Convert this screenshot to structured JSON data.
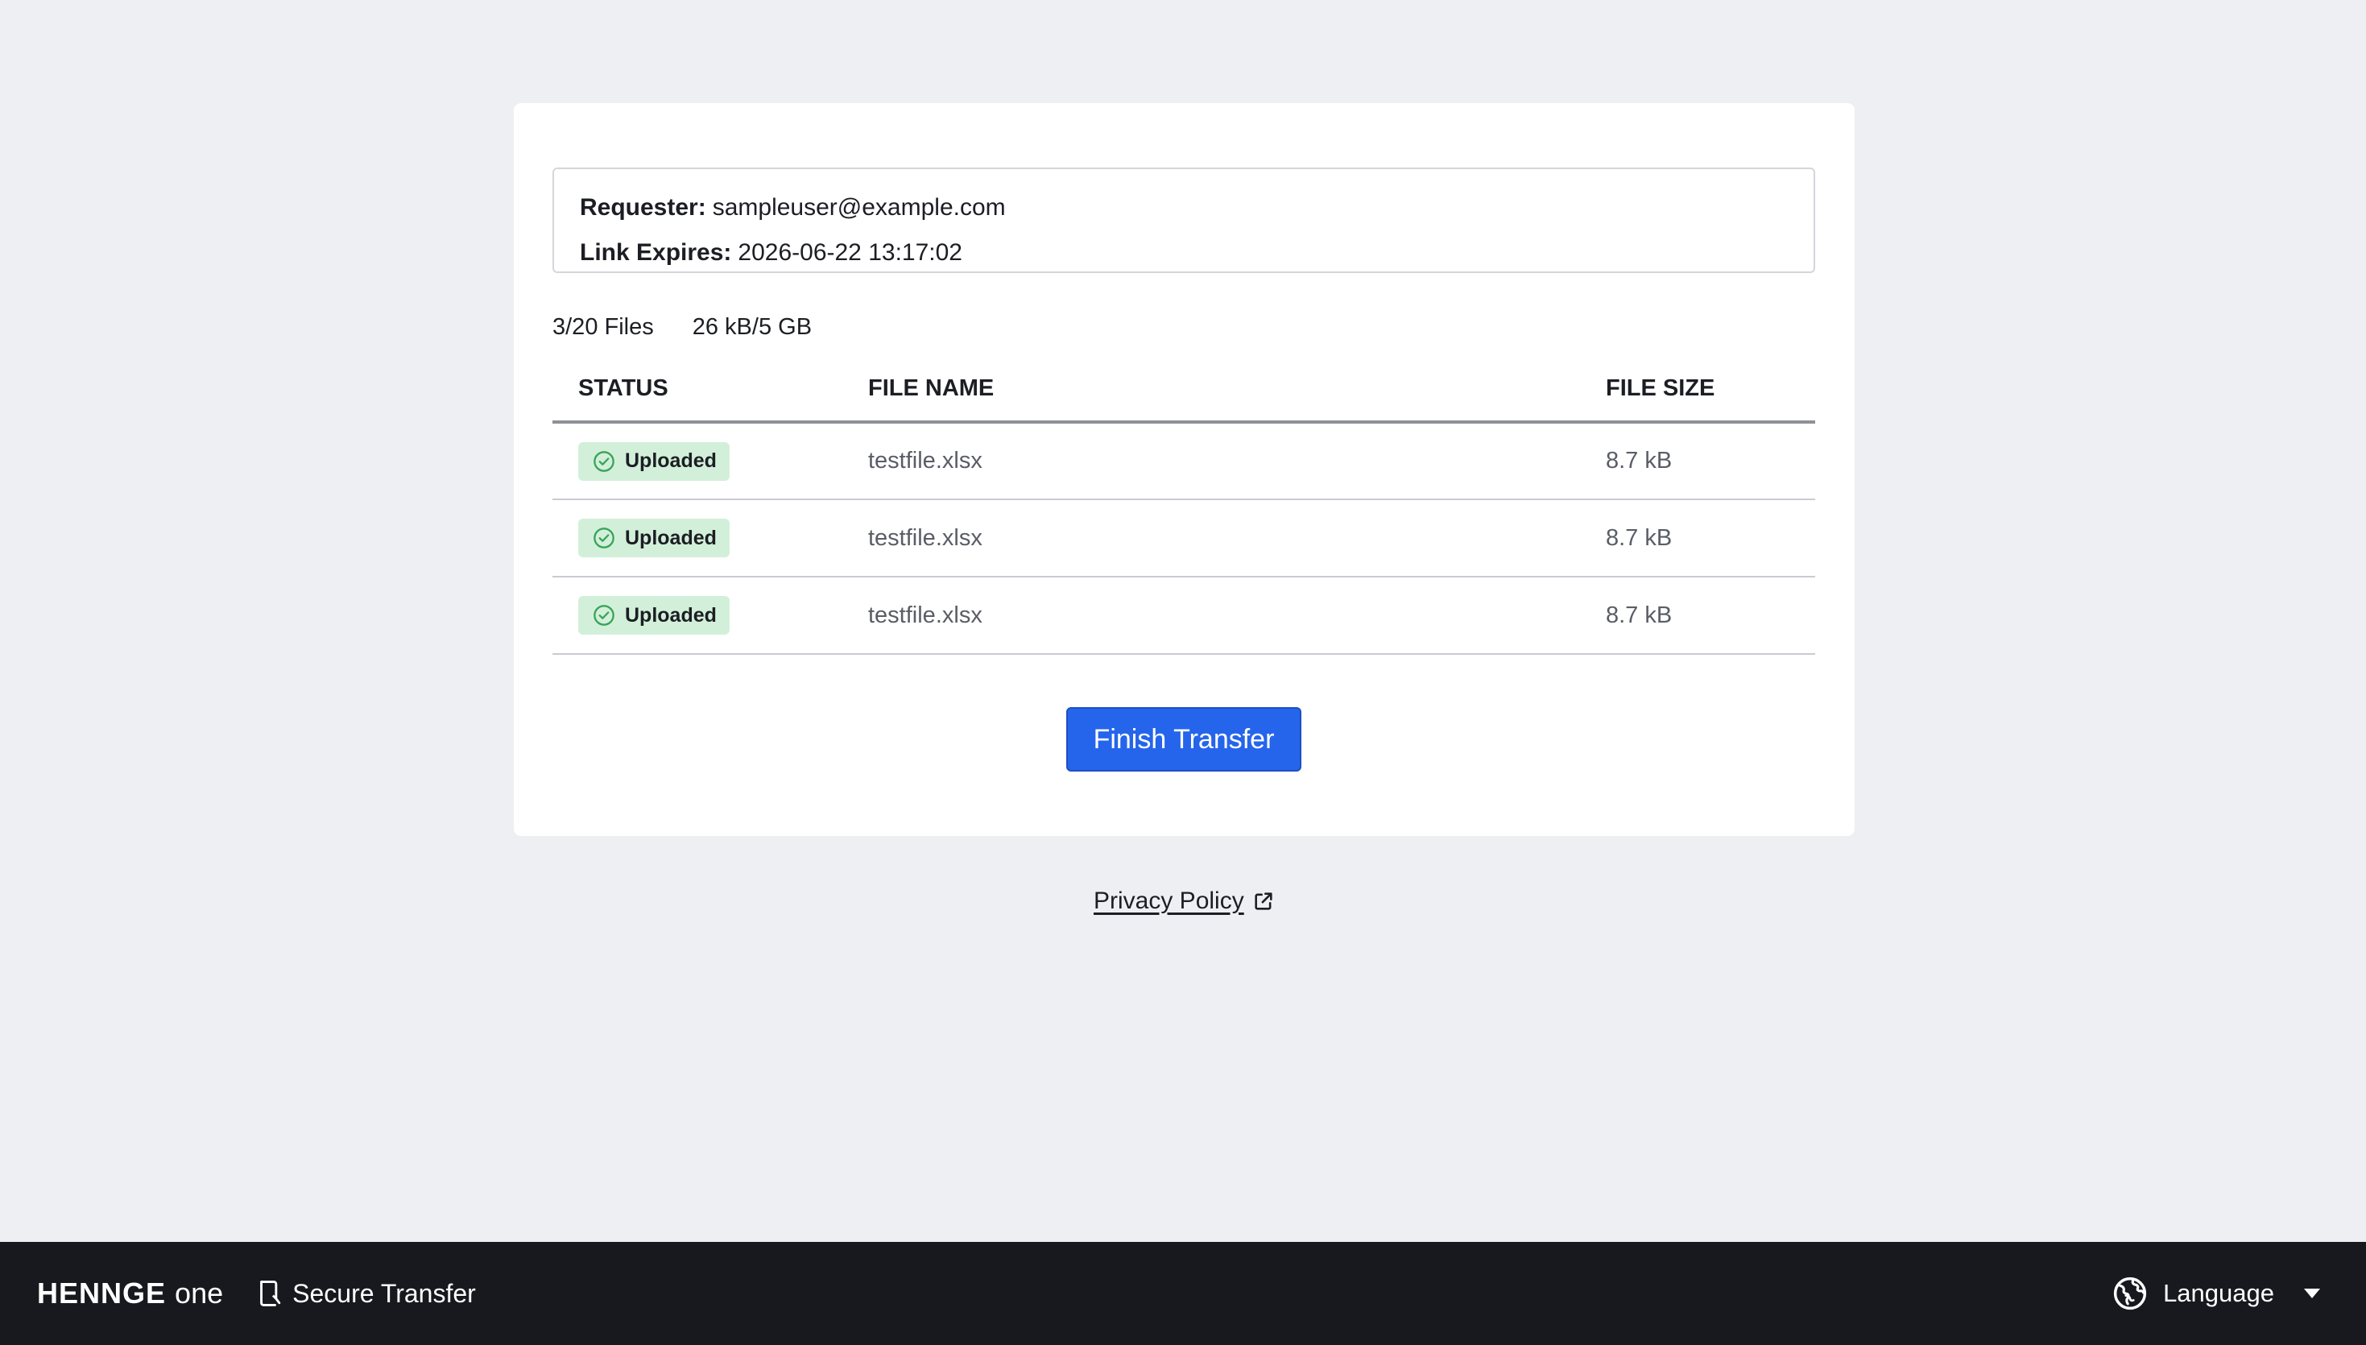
{
  "request": {
    "requester_label": "Requester:",
    "requester_value": "sampleuser@example.com",
    "expires_label": "Link Expires:",
    "expires_value": "2026-06-22 13:17:02"
  },
  "summary": {
    "file_count": "3/20 Files",
    "size_usage": "26 kB/5 GB"
  },
  "table": {
    "headers": {
      "status": "STATUS",
      "file_name": "FILE NAME",
      "file_size": "FILE SIZE"
    },
    "rows": [
      {
        "status": "Uploaded",
        "file_name": "testfile.xlsx",
        "file_size": "8.7 kB"
      },
      {
        "status": "Uploaded",
        "file_name": "testfile.xlsx",
        "file_size": "8.7 kB"
      },
      {
        "status": "Uploaded",
        "file_name": "testfile.xlsx",
        "file_size": "8.7 kB"
      }
    ]
  },
  "actions": {
    "finish_label": "Finish Transfer"
  },
  "links": {
    "privacy_label": "Privacy Policy"
  },
  "footer": {
    "brand_main": "HENNGE",
    "brand_suffix": "one",
    "product_name": "Secure Transfer",
    "language_label": "Language"
  },
  "icons": {
    "status": "check-circle-icon",
    "privacy": "external-link-icon",
    "product": "secure-transfer-icon",
    "language": "globe-icon",
    "dropdown": "caret-down-icon"
  },
  "colors": {
    "primary": "#2565ec",
    "success_bg": "#d2f0d9",
    "success_icon": "#3aa35b",
    "footer_bg": "#17191e",
    "page_bg": "#eeeff3"
  }
}
